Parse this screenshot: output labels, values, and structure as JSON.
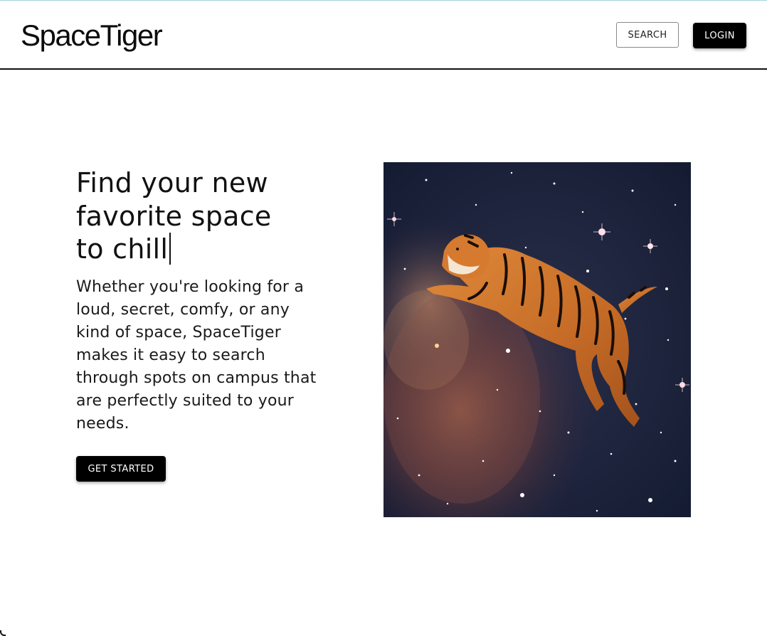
{
  "header": {
    "logo": "SpaceTiger",
    "search_label": "SEARCH",
    "login_label": "LOGIN"
  },
  "hero": {
    "title": "Find your new\nfavorite space\nto chill",
    "description": "Whether you're looking for a loud, secret, comfy, or any kind of space, SpaceTiger makes it easy to search through spots on campus that are perfectly suited to your needs.",
    "cta_label": "GET STARTED",
    "image_icon": "tiger-in-space-image"
  },
  "colors": {
    "primary_button": "#000000",
    "background": "#ffffff",
    "top_accent": "#9fd3dc"
  }
}
